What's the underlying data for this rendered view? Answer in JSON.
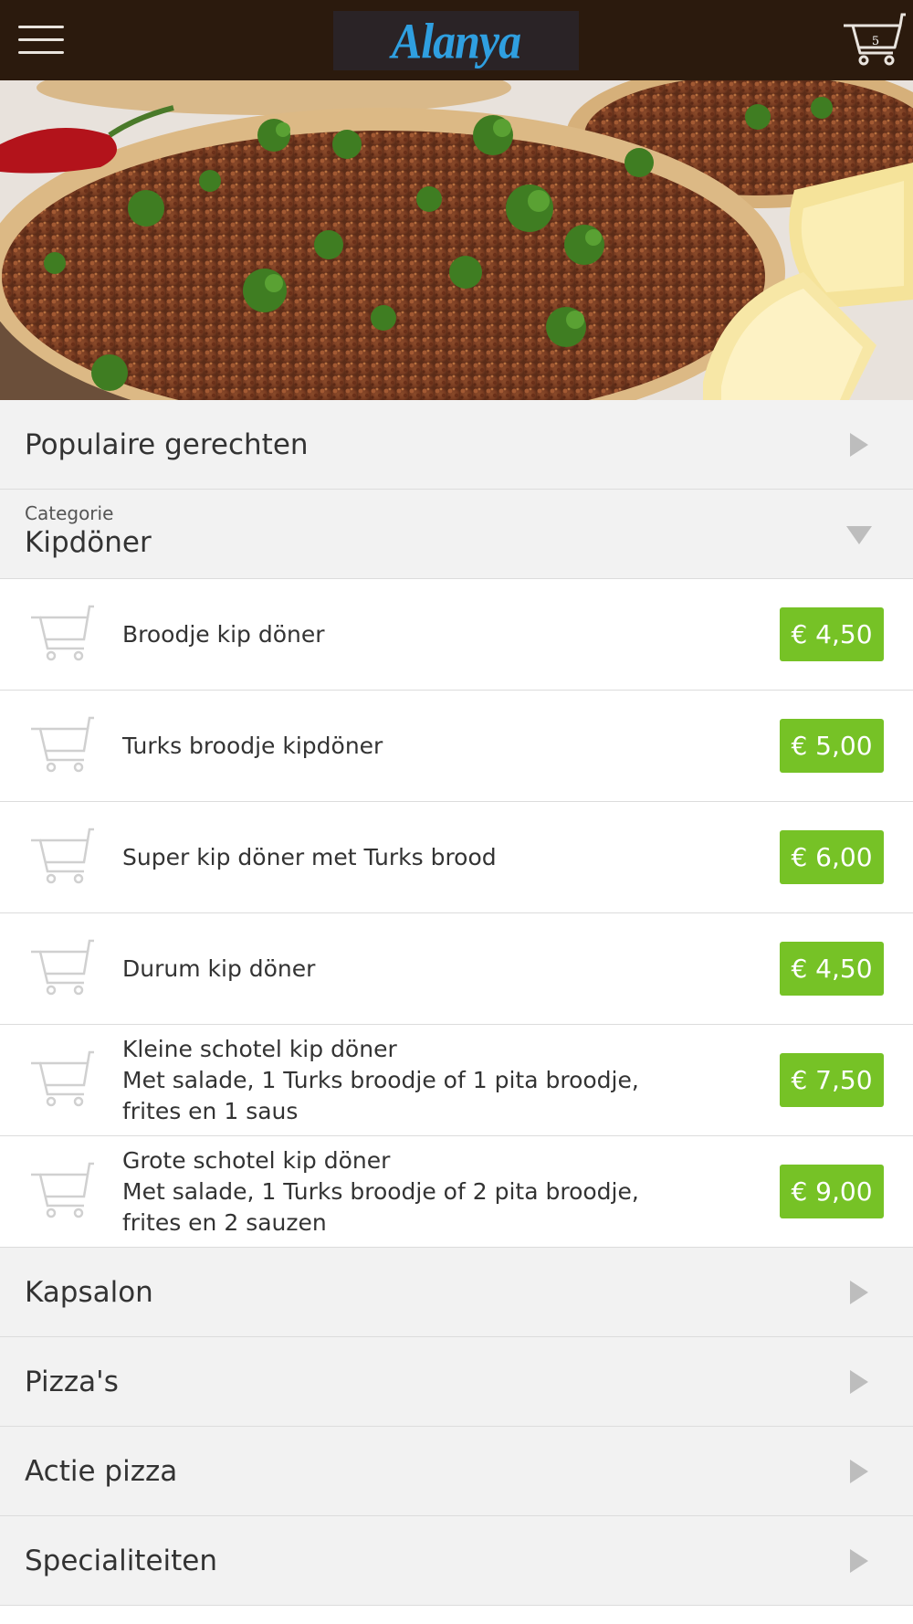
{
  "header": {
    "menu_icon": "hamburger-menu-icon",
    "logo_text": "Alanya",
    "cart_icon": "shopping-cart-icon",
    "cart_count": "5"
  },
  "hero": {
    "alt": "lahmacun-photo"
  },
  "popular": {
    "label": "Populaire gerechten"
  },
  "category_select": {
    "small_label": "Categorie",
    "current": "Kipdöner"
  },
  "items": [
    {
      "name": "Broodje kip döner",
      "desc": "",
      "price": "€ 4,50"
    },
    {
      "name": "Turks broodje kipdöner",
      "desc": "",
      "price": "€ 5,00"
    },
    {
      "name": "Super kip döner met Turks brood",
      "desc": "",
      "price": "€ 6,00"
    },
    {
      "name": "Durum kip döner",
      "desc": "",
      "price": "€ 4,50"
    },
    {
      "name": "Kleine schotel kip döner",
      "desc": "Met salade, 1 Turks broodje of 1 pita broodje, frites en 1 saus",
      "price": "€ 7,50"
    },
    {
      "name": "Grote schotel kip döner",
      "desc": "Met salade, 1 Turks broodje of 2 pita broodje, frites en 2 sauzen",
      "price": "€ 9,00"
    }
  ],
  "categories": [
    {
      "label": "Kapsalon"
    },
    {
      "label": "Pizza's"
    },
    {
      "label": "Actie pizza"
    },
    {
      "label": "Specialiteiten"
    }
  ],
  "colors": {
    "header_bg": "#2b1a0d",
    "logo": "#2f9fe0",
    "price_bg": "#76c226",
    "row_bg": "#f2f2f2"
  }
}
